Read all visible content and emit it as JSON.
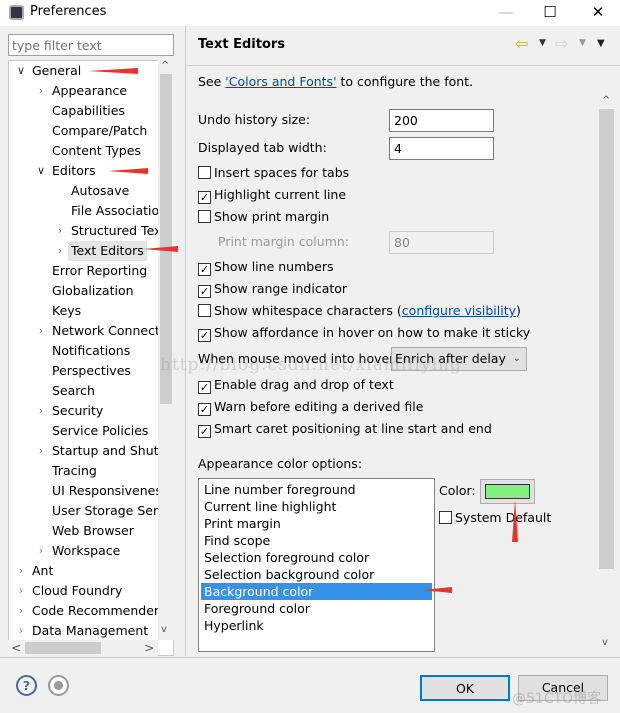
{
  "window": {
    "title": "Preferences",
    "minimize": "—",
    "maximize": "☐",
    "close": "✕"
  },
  "filter": {
    "placeholder": "type filter text"
  },
  "tree": [
    {
      "label": "General",
      "level": 0,
      "expander": "open"
    },
    {
      "label": "Appearance",
      "level": 1,
      "expander": "closed"
    },
    {
      "label": "Capabilities",
      "level": 1,
      "expander": "none"
    },
    {
      "label": "Compare/Patch",
      "level": 1,
      "expander": "none"
    },
    {
      "label": "Content Types",
      "level": 1,
      "expander": "none"
    },
    {
      "label": "Editors",
      "level": 1,
      "expander": "open"
    },
    {
      "label": "Autosave",
      "level": 2,
      "expander": "none"
    },
    {
      "label": "File Associations",
      "level": 2,
      "expander": "none"
    },
    {
      "label": "Structured Text",
      "level": 2,
      "expander": "closed"
    },
    {
      "label": "Text Editors",
      "level": 2,
      "expander": "closed",
      "selected": true
    },
    {
      "label": "Error Reporting",
      "level": 1,
      "expander": "none"
    },
    {
      "label": "Globalization",
      "level": 1,
      "expander": "none"
    },
    {
      "label": "Keys",
      "level": 1,
      "expander": "none"
    },
    {
      "label": "Network Connections",
      "level": 1,
      "expander": "closed"
    },
    {
      "label": "Notifications",
      "level": 1,
      "expander": "none"
    },
    {
      "label": "Perspectives",
      "level": 1,
      "expander": "none"
    },
    {
      "label": "Search",
      "level": 1,
      "expander": "none"
    },
    {
      "label": "Security",
      "level": 1,
      "expander": "closed"
    },
    {
      "label": "Service Policies",
      "level": 1,
      "expander": "none"
    },
    {
      "label": "Startup and Shutdown",
      "level": 1,
      "expander": "closed"
    },
    {
      "label": "Tracing",
      "level": 1,
      "expander": "none"
    },
    {
      "label": "UI Responsiveness",
      "level": 1,
      "expander": "none"
    },
    {
      "label": "User Storage Service",
      "level": 1,
      "expander": "none"
    },
    {
      "label": "Web Browser",
      "level": 1,
      "expander": "none"
    },
    {
      "label": "Workspace",
      "level": 1,
      "expander": "closed"
    },
    {
      "label": "Ant",
      "level": 0,
      "expander": "closed"
    },
    {
      "label": "Cloud Foundry",
      "level": 0,
      "expander": "closed"
    },
    {
      "label": "Code Recommenders",
      "level": 0,
      "expander": "closed"
    },
    {
      "label": "Data Management",
      "level": 0,
      "expander": "closed"
    }
  ],
  "page": {
    "title": "Text Editors",
    "see_prefix": "See ",
    "see_link": "'Colors and Fonts'",
    "see_suffix": " to configure the font.",
    "undo_label": "Undo history size:",
    "undo_value": "200",
    "tab_label": "Displayed tab width:",
    "tab_value": "4",
    "checks1": [
      {
        "label": "Insert spaces for tabs",
        "checked": false
      },
      {
        "label": "Highlight current line",
        "checked": true
      },
      {
        "label": "Show print margin",
        "checked": false
      }
    ],
    "print_margin_label": "Print margin column:",
    "print_margin_value": "80",
    "checks2": [
      {
        "label": "Show line numbers",
        "checked": true
      },
      {
        "label": "Show range indicator",
        "checked": true
      },
      {
        "label": "Show whitespace characters",
        "checked": false,
        "link": "configure visibility"
      },
      {
        "label": "Show affordance in hover on how to make it sticky",
        "checked": true
      }
    ],
    "hover_label": "When mouse moved into hover:",
    "hover_value": "Enrich after delay",
    "checks3": [
      {
        "label": "Enable drag and drop of text",
        "checked": true
      },
      {
        "label": "Warn before editing a derived file",
        "checked": true
      },
      {
        "label": "Smart caret positioning at line start and end",
        "checked": true
      }
    ],
    "appearance_label": "Appearance color options:",
    "color_options": [
      "Line number foreground",
      "Current line highlight",
      "Print margin",
      "Find scope",
      "Selection foreground color",
      "Selection background color",
      "Background color",
      "Foreground color",
      "Hyperlink"
    ],
    "selected_option": "Background color",
    "color_label": "Color:",
    "color_value": "#80f080",
    "system_default_label": "System Default",
    "system_default_checked": false
  },
  "buttons": {
    "ok": "OK",
    "cancel": "Cancel"
  },
  "watermarks": {
    "blog": "http://blog.csdn.net/xiamiflying",
    "site": "@51CTO博客"
  },
  "colors": {
    "selection": "#3592ea",
    "annotation_arrow": "#e8342c",
    "link": "#0645ad"
  }
}
